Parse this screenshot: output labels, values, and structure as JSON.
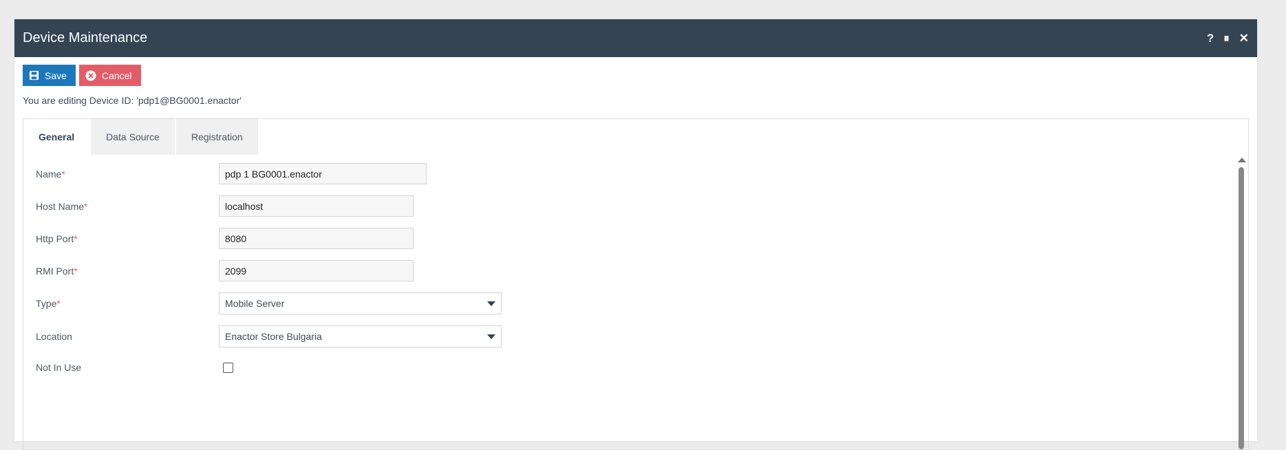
{
  "window": {
    "title": "Device Maintenance",
    "controls": {
      "help": "?",
      "pause": "⏸",
      "close": "✕"
    }
  },
  "toolbar": {
    "save_label": "Save",
    "cancel_label": "Cancel"
  },
  "editing_text": "You are editing Device ID: 'pdp1@BG0001.enactor'",
  "tabs": [
    {
      "label": "General",
      "active": true
    },
    {
      "label": "Data Source",
      "active": false
    },
    {
      "label": "Registration",
      "active": false
    }
  ],
  "form": {
    "name": {
      "label": "Name",
      "required": "*",
      "value": "pdp 1 BG0001.enactor"
    },
    "host_name": {
      "label": "Host Name",
      "required": "*",
      "value": "localhost"
    },
    "http_port": {
      "label": "Http Port",
      "required": "*",
      "value": "8080"
    },
    "rmi_port": {
      "label": "RMI Port",
      "required": "*",
      "value": "2099"
    },
    "type": {
      "label": "Type",
      "required": "*",
      "value": "Mobile Server"
    },
    "location": {
      "label": "Location",
      "value": "Enactor Store Bulgaria"
    },
    "not_in_use": {
      "label": "Not In Use",
      "checked": false
    }
  },
  "colors": {
    "titlebar": "#354453",
    "save": "#1d77bb",
    "cancel": "#e35d68",
    "required": "#e35d68"
  },
  "icons": {
    "save": "floppy-disk-icon",
    "cancel": "x-circle-icon"
  }
}
